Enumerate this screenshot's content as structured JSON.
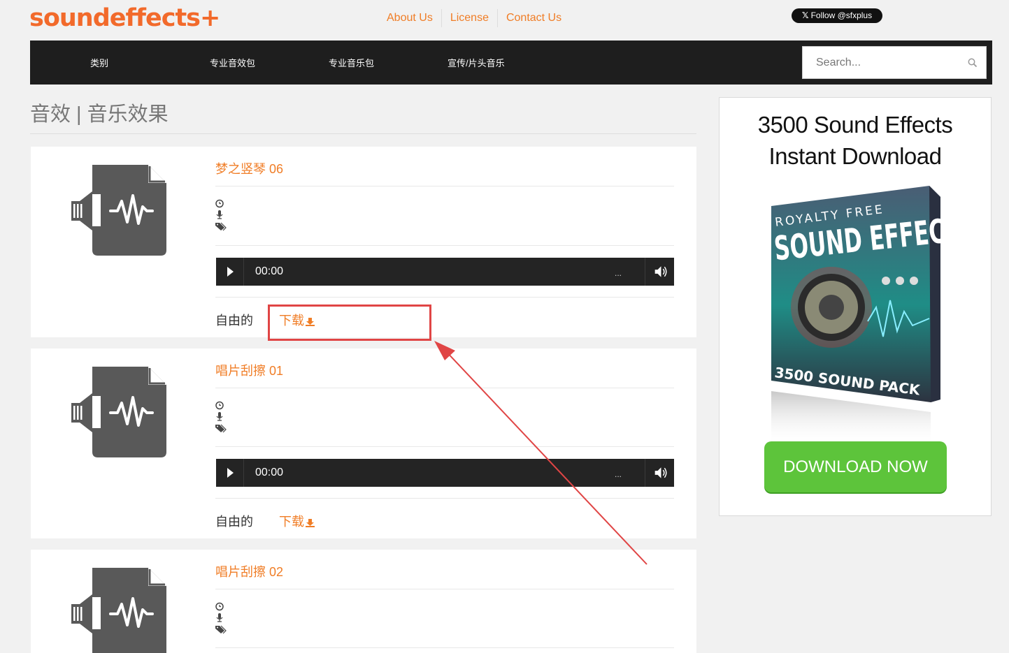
{
  "header": {
    "logo": "soundeffects+",
    "links": [
      "About Us",
      "License",
      "Contact Us"
    ],
    "follow": "Follow @sfxplus"
  },
  "nav": {
    "items": [
      "类别",
      "专业音效包",
      "专业音乐包",
      "宣传/片头音乐"
    ],
    "search_placeholder": "Search..."
  },
  "page": {
    "title": "音效 | 音乐效果"
  },
  "tracks": [
    {
      "title": "梦之竖琴 06",
      "time": "00:00",
      "dots": "...",
      "license": "自由的",
      "download": "下载"
    },
    {
      "title": "唱片刮擦 01",
      "time": "00:00",
      "dots": "...",
      "license": "自由的",
      "download": "下载"
    },
    {
      "title": "唱片刮擦 02"
    }
  ],
  "ad": {
    "line1": "3500 Sound Effects",
    "line2": "Instant Download",
    "box_top": "ROYALTY FREE",
    "box_main": "SOUND EFFECTS",
    "box_bottom": "3500 SOUND PACK",
    "button": "DOWNLOAD NOW"
  },
  "colors": {
    "accent": "#f07d26",
    "nav_bg": "#1e1e1e",
    "annotation": "#e04545",
    "ad_button": "#5dc43b"
  }
}
